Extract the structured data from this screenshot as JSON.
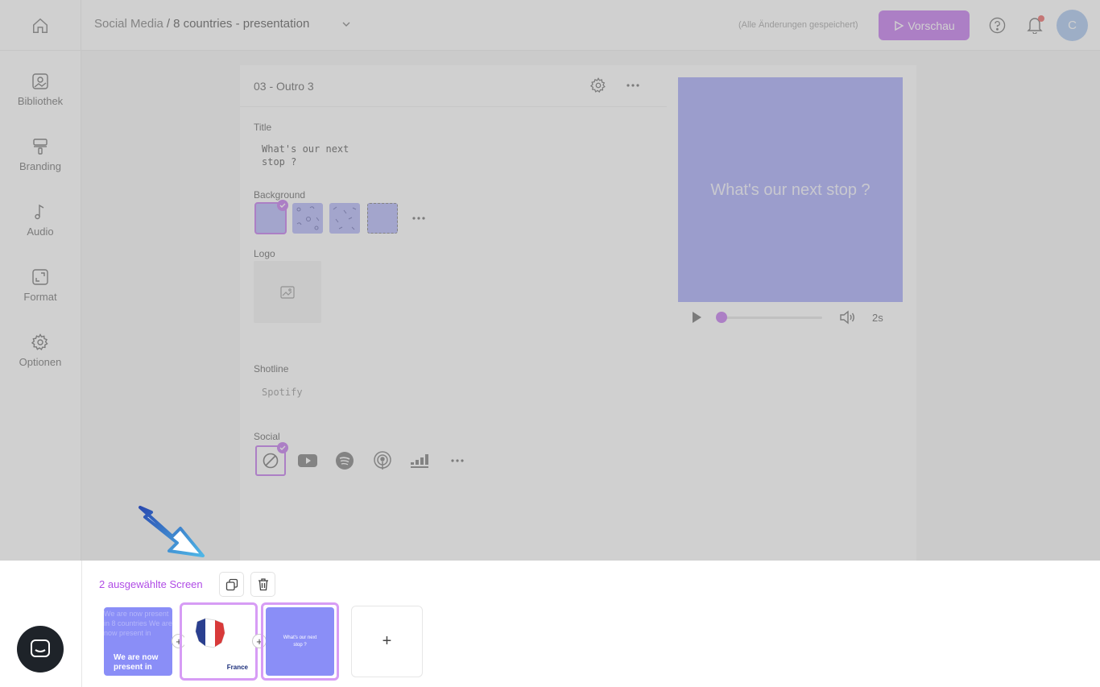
{
  "header": {
    "breadcrumb_parent": "Social Media",
    "breadcrumb_current": "8 countries - presentation",
    "saved_status": "(Alle Änderungen gespeichert)",
    "preview_label": "Vorschau",
    "avatar_initial": "C"
  },
  "sidebar": {
    "items": [
      {
        "label": "Bibliothek",
        "icon": "image-icon"
      },
      {
        "label": "Branding",
        "icon": "paint-roller-icon"
      },
      {
        "label": "Audio",
        "icon": "music-note-icon"
      },
      {
        "label": "Format",
        "icon": "resize-icon"
      },
      {
        "label": "Optionen",
        "icon": "gear-icon"
      }
    ]
  },
  "editor": {
    "screen_name": "03 - Outro 3",
    "title_label": "Title",
    "title_value": "What's our next stop ?",
    "background_label": "Background",
    "logo_label": "Logo",
    "shotline_label": "Shotline",
    "shotline_placeholder": "Spotify",
    "social_label": "Social",
    "social_options": [
      "none-icon",
      "youtube-icon",
      "spotify-icon",
      "podcast-icon",
      "deezer-icon"
    ]
  },
  "preview": {
    "text": "What's our next stop ?",
    "duration": "2s",
    "progress": 0
  },
  "strip": {
    "selected_count": "2 ausgewählte Screen",
    "thumbs": [
      {
        "background_text": "We are now present in 8 countries We are now present in",
        "text": "We are now present in"
      },
      {
        "label": "France"
      },
      {
        "label": "What's our next stop ?"
      }
    ],
    "add_label": "+"
  },
  "colors": {
    "accent": "#b04ce6",
    "preview_bg": "#8a8ef7"
  }
}
